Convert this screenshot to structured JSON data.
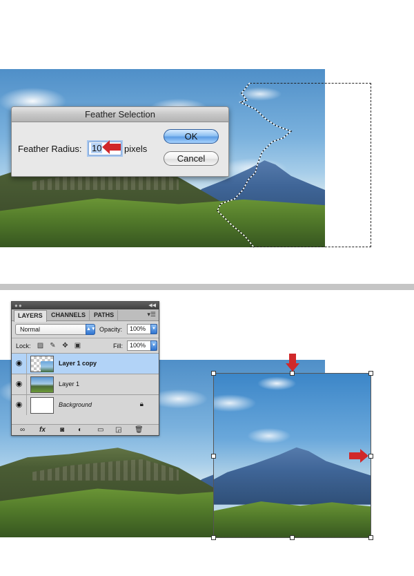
{
  "feather_dialog": {
    "title": "Feather Selection",
    "radius_label": "Feather Radius:",
    "radius_value": "10",
    "unit": "pixels",
    "ok_label": "OK",
    "cancel_label": "Cancel"
  },
  "layers_panel": {
    "tabs": [
      {
        "label": "LAYERS",
        "active": true
      },
      {
        "label": "CHANNELS",
        "active": false
      },
      {
        "label": "PATHS",
        "active": false
      }
    ],
    "blend_mode": "Normal",
    "opacity_label": "Opacity:",
    "opacity_value": "100%",
    "lock_label": "Lock:",
    "fill_label": "Fill:",
    "fill_value": "100%",
    "layers": [
      {
        "name": "Layer 1 copy",
        "visible": true,
        "selected": true
      },
      {
        "name": "Layer 1",
        "visible": true,
        "selected": false
      },
      {
        "name": "Background",
        "visible": true,
        "selected": false,
        "locked": true
      }
    ],
    "footer_icons": [
      "link-icon",
      "fx-icon",
      "mask-icon",
      "adjustment-icon",
      "folder-icon",
      "new-layer-icon",
      "trash-icon"
    ]
  },
  "colors": {
    "accent_blue": "#5d9de4",
    "selected_layer": "#b2d3f7",
    "arrow_red": "#d0282a"
  }
}
